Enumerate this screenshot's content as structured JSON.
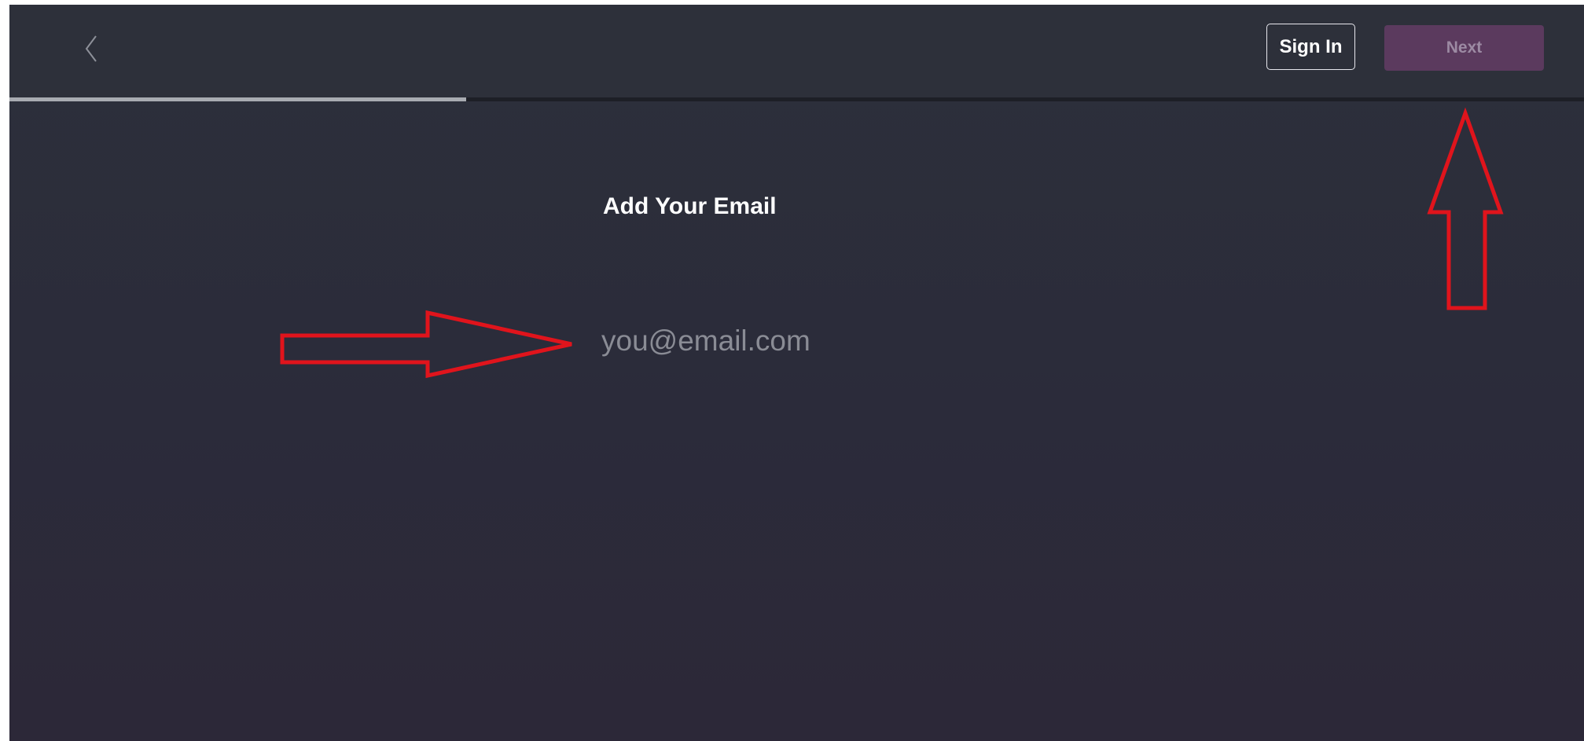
{
  "header": {
    "back_icon": "chevron-left-icon",
    "sign_in_label": "Sign In",
    "next_label": "Next",
    "next_color": "#5b3a5e"
  },
  "progress": {
    "fraction": 0.29
  },
  "main": {
    "title": "Add Your Email",
    "email_placeholder": "you@email.com",
    "email_value": ""
  },
  "annotations": {
    "arrow_color": "#e0141c",
    "arrows": [
      "arrow-pointing-right-at-email-input",
      "arrow-pointing-up-at-next-button"
    ]
  }
}
